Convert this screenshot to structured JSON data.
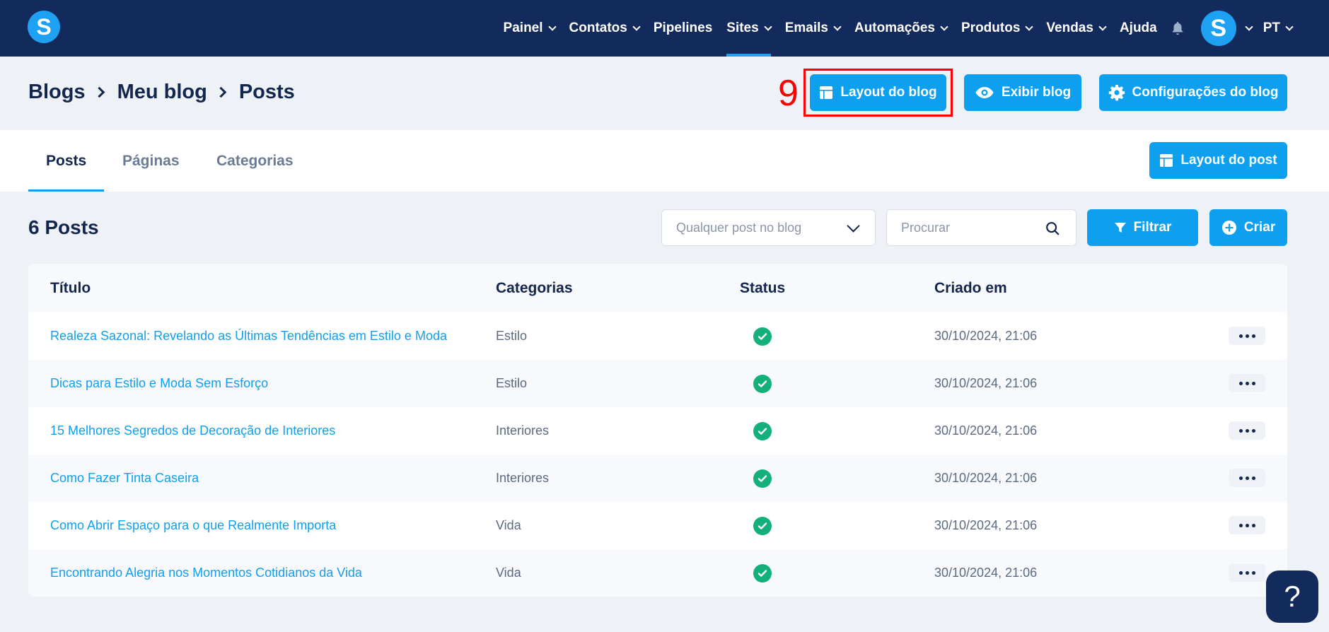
{
  "app": {
    "logo_letter": "S"
  },
  "nav": {
    "items": [
      {
        "label": "Painel",
        "dropdown": true
      },
      {
        "label": "Contatos",
        "dropdown": true
      },
      {
        "label": "Pipelines",
        "dropdown": false
      },
      {
        "label": "Sites",
        "dropdown": true,
        "active": true
      },
      {
        "label": "Emails",
        "dropdown": true
      },
      {
        "label": "Automações",
        "dropdown": true
      },
      {
        "label": "Produtos",
        "dropdown": true
      },
      {
        "label": "Vendas",
        "dropdown": true
      },
      {
        "label": "Ajuda",
        "dropdown": false
      }
    ],
    "avatar_letter": "S",
    "language": "PT"
  },
  "breadcrumb": [
    "Blogs",
    "Meu blog",
    "Posts"
  ],
  "header_buttons": {
    "layout_blog": "Layout do blog",
    "view_blog": "Exibir blog",
    "blog_settings": "Configurações do blog"
  },
  "annotation": {
    "step_number": "9",
    "color": "#ff0000"
  },
  "tabs": [
    {
      "label": "Posts",
      "active": true
    },
    {
      "label": "Páginas",
      "active": false
    },
    {
      "label": "Categorias",
      "active": false
    }
  ],
  "post_layout_button": "Layout do post",
  "toolbar": {
    "count_label": "6 Posts",
    "filter_select": "Qualquer post no blog",
    "search_placeholder": "Procurar",
    "filter_button": "Filtrar",
    "create_button": "Criar"
  },
  "table": {
    "columns": [
      "Título",
      "Categorias",
      "Status",
      "Criado em"
    ],
    "rows": [
      {
        "title": "Realeza Sazonal: Revelando as Últimas Tendências em Estilo e Moda",
        "category": "Estilo",
        "status": "published",
        "created": "30/10/2024, 21:06"
      },
      {
        "title": "Dicas para Estilo e Moda Sem Esforço",
        "category": "Estilo",
        "status": "published",
        "created": "30/10/2024, 21:06"
      },
      {
        "title": "15 Melhores Segredos de Decoração de Interiores",
        "category": "Interiores",
        "status": "published",
        "created": "30/10/2024, 21:06"
      },
      {
        "title": "Como Fazer Tinta Caseira",
        "category": "Interiores",
        "status": "published",
        "created": "30/10/2024, 21:06"
      },
      {
        "title": "Como Abrir Espaço para o que Realmente Importa",
        "category": "Vida",
        "status": "published",
        "created": "30/10/2024, 21:06"
      },
      {
        "title": "Encontrando Alegria nos Momentos Cotidianos da Vida",
        "category": "Vida",
        "status": "published",
        "created": "30/10/2024, 21:06"
      }
    ]
  },
  "help_button": "?",
  "colors": {
    "nav_bg": "#132a5d",
    "accent": "#0ea0ef",
    "status_ok": "#13b07a",
    "highlight": "#ff0000"
  }
}
